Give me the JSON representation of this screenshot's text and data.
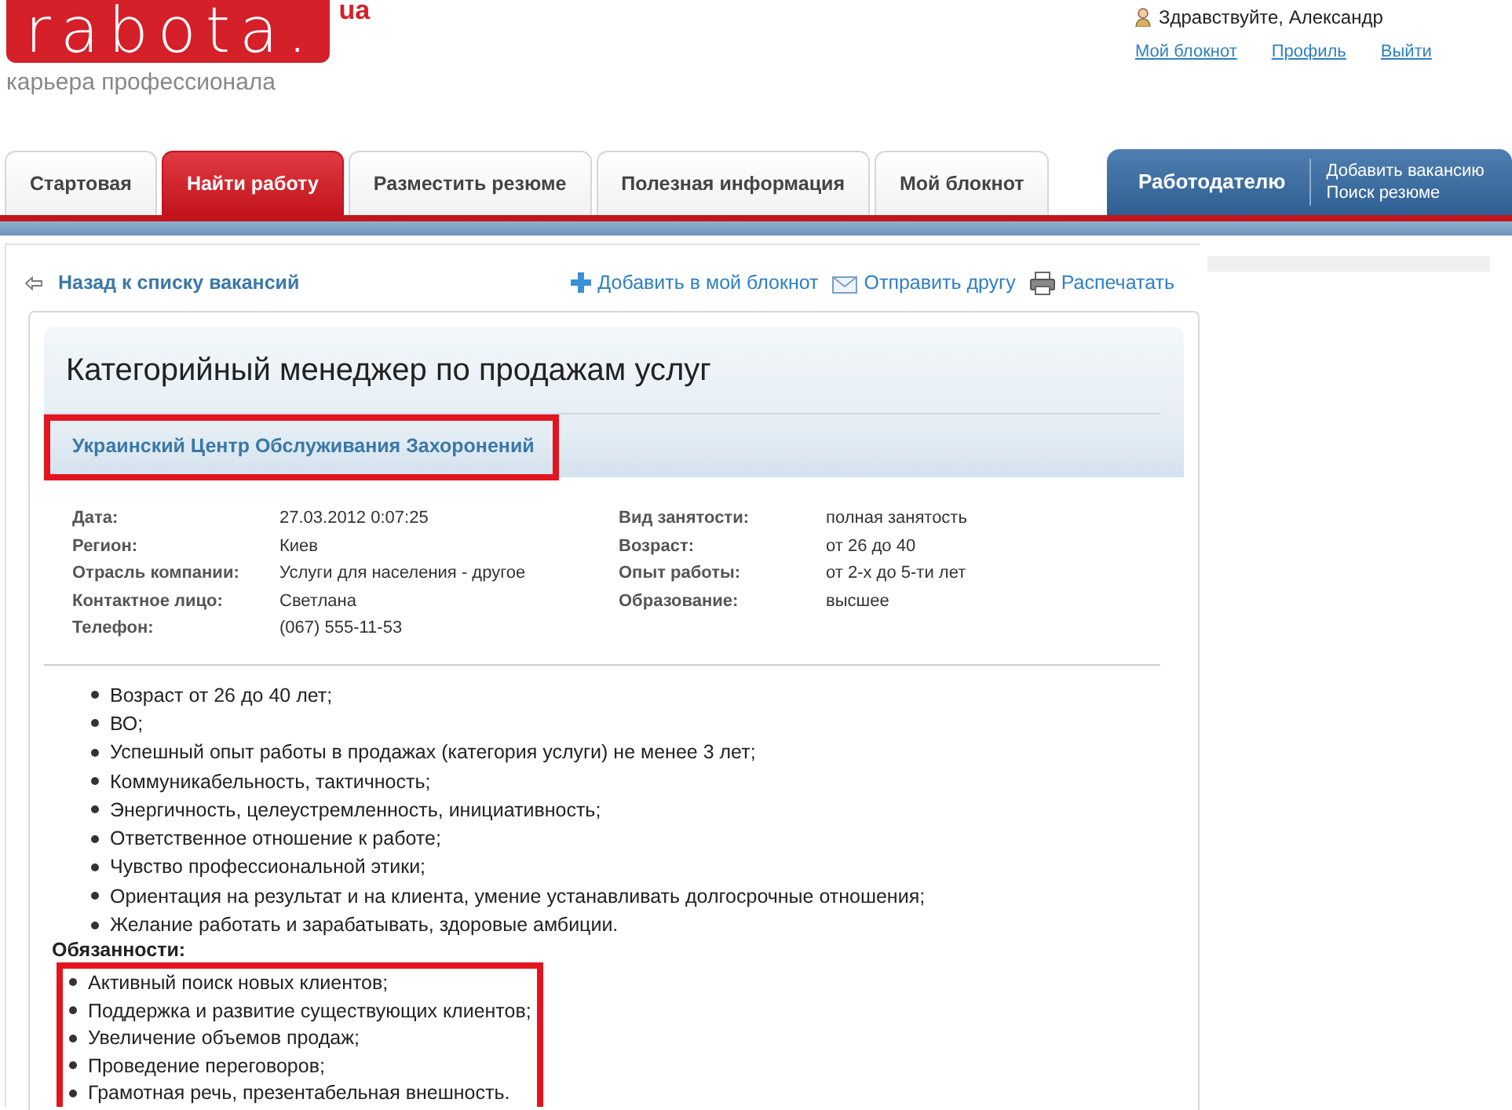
{
  "logo": {
    "wordmark": "rabota.",
    "domain": "ua",
    "tagline": "карьера профессионала"
  },
  "user": {
    "greeting": "Здравствуйте, Александр",
    "links": [
      "Мой блокнот",
      "Профиль",
      "Выйти"
    ]
  },
  "tabs": [
    {
      "label": "Стартовая",
      "selected": false
    },
    {
      "label": "Найти работу",
      "selected": true
    },
    {
      "label": "Разместить резюме",
      "selected": false
    },
    {
      "label": "Полезная информация",
      "selected": false
    },
    {
      "label": "Мой блокнот",
      "selected": false
    }
  ],
  "employer": {
    "label": "Работодателю",
    "links": [
      "Добавить вакансию",
      "Поиск резюме"
    ]
  },
  "toolbar": {
    "back": "Назад к списку вакансий",
    "actions": [
      {
        "kind": "add",
        "label": "Добавить в мой блокнот"
      },
      {
        "kind": "mail",
        "label": "Отправить другу"
      },
      {
        "kind": "print",
        "label": "Распечатать"
      }
    ]
  },
  "vacancy": {
    "title": "Категорийный менеджер по продажам услуг",
    "company": {
      "name": "Украинский Центр Обслуживания Захоронений",
      "highlighted": true
    },
    "details_left": [
      {
        "label": "Дата:",
        "value": "27.03.2012 0:07:25"
      },
      {
        "label": "Регион:",
        "value": "Киев"
      },
      {
        "label": "Отрасль компании:",
        "value": "Услуги для населения - другое"
      },
      {
        "label": "Контактное лицо:",
        "value": "Светлана"
      },
      {
        "label": "Телефон:",
        "value": "(067) 555-11-53"
      }
    ],
    "details_right": [
      {
        "label": "Вид занятости:",
        "value": "полная занятость"
      },
      {
        "label": "Возраст:",
        "value": "от 26 до 40"
      },
      {
        "label": "Опыт работы:",
        "value": "от 2-х до 5-ти лет"
      },
      {
        "label": "Образование:",
        "value": "высшее"
      }
    ],
    "requirements": [
      "Возраст от 26 до 40 лет;",
      "ВО;",
      "Успешный опыт работы в продажах (категория услуги) не менее 3 лет;",
      "Коммуникабельность, тактичность;",
      "Энергичность, целеустремленность, инициативность;",
      "Ответственное отношение к работе;",
      "Чувство профессиональной этики;",
      "Ориентация на результат и на клиента, умение устанавливать долгосрочные отношения;",
      "Желание работать и зарабатывать, здоровые амбиции."
    ],
    "duties": {
      "heading": "Обязанности:",
      "highlighted": true,
      "items": [
        "Активный поиск новых клиентов;",
        "Поддержка и развитие существующих клиентов;",
        "Увеличение объемов продаж;",
        "Проведение переговоров;",
        "Грамотная речь, презентабельная внешность."
      ]
    }
  }
}
